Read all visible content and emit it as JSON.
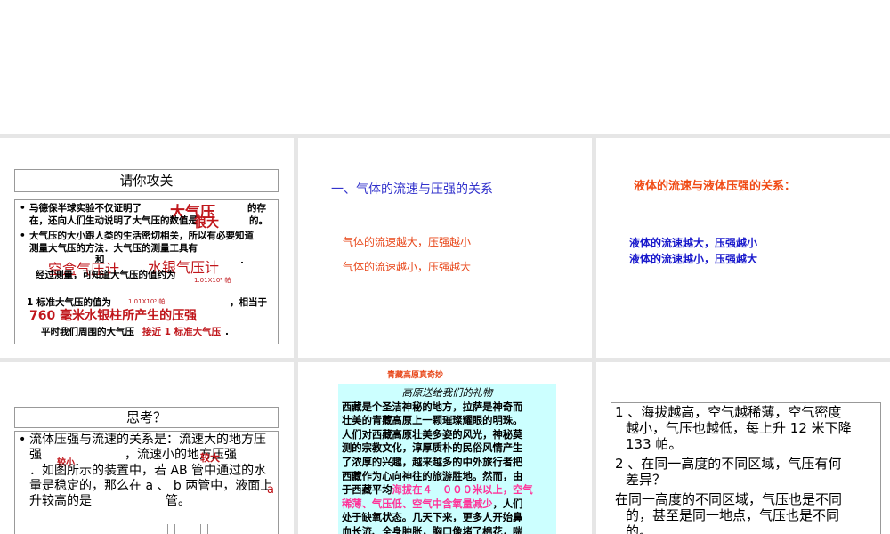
{
  "slide1": {
    "title": "请你攻关",
    "b1_a": "马德保半球实验不仅证明了",
    "b1_ans1": "大气压",
    "b1_b": "的存",
    "b1_c": "在，还向人们生动说明了大气压的数值是",
    "b1_ans2": "很大",
    "b1_d": "的。",
    "b2_a": "大气压的大小跟人类的生活密切相关，所以有必要知道",
    "b2_b": "测量大气压的方法．大气压的测量工具有",
    "b2_and": "和",
    "b2_ans1": "空盒气压计",
    "b2_ans2": "水银气压计",
    "b2_dot": ".",
    "b2_c": "经过测量，可知道大气压的值约为",
    "b2_ans3": "1.01X10⁵ 帕",
    "l3_a": "1 标准大气压的值为",
    "l3_ans": "1.01X10⁵ 帕",
    "l3_b": "，相当于",
    "l3_ans2": "760 毫米水银柱所产生的压强",
    "l4_a": "平时我们周围的大气压",
    "l4_ans": "接近 1 标准大气压",
    "l4_b": "."
  },
  "slide2": {
    "heading": "一、气体的流速与压强的关系",
    "line1": "气体的流速越大，压强越小",
    "line2": "气体的流速越小，压强越大"
  },
  "slide3": {
    "heading": "液体的流速与液体压强的关系：",
    "line1": "液体的流速越大，压强越小",
    "line2": "液体的流速越小，压强越大"
  },
  "slide4": {
    "title": "思考？",
    "l1": "流体压强与流速的关系是：流速大的地方压",
    "l2a": "强",
    "ans1": "较小",
    "l2b": "，流速小的地方压强",
    "ans2": "较大",
    "l3": "．如图所示的装置中，若 AB 管中通过的水",
    "l4": "量是稳定的，那么在 a 、 b 两管中，液面上",
    "ans3": "a",
    "l5a": "升较高的是",
    "l5b": "管。"
  },
  "slide5": {
    "title": "青藏高原真奇妙",
    "box_title": "高原送给我们的礼物",
    "lines": [
      "西藏是个圣洁神秘的地方，拉萨是神奇而",
      "壮美的青藏高原上一颗璀璨耀眼的明珠。",
      "人们对西藏高原壮美多姿的风光，神秘莫",
      "测的宗教文化，淳厚质朴的民俗风情产生",
      "了浓厚的兴趣，越来越多的中外旅行者把",
      "西藏作为心向神往的旅游胜地。然而，由"
    ],
    "l7a": "于西藏平均",
    "l7b": "海拔在４　０００米以上，空气",
    "l8a": "稀薄、气压低、空气中含氧量减少",
    "l8b": "，人们",
    "l9": "处于缺氧状态。几天下来，更多人开始鼻",
    "l10": "血长流、全身肿胀，胸口像堵了棉花，喘"
  },
  "slide6": {
    "p1a": "1 、海拔越高，空气越稀薄，空气密度",
    "p1b": "越小，气压也越低，每上升 12 米下降",
    "p1c": "133 帕。",
    "p2a": "2 、在同一高度的不同区域，气压有何",
    "p2b": "差异？",
    "p3a": "在同一高度的不同区域，气压也是不同",
    "p3b": "的，甚至是同一地点，气压也是不同",
    "p3c": "的。"
  }
}
